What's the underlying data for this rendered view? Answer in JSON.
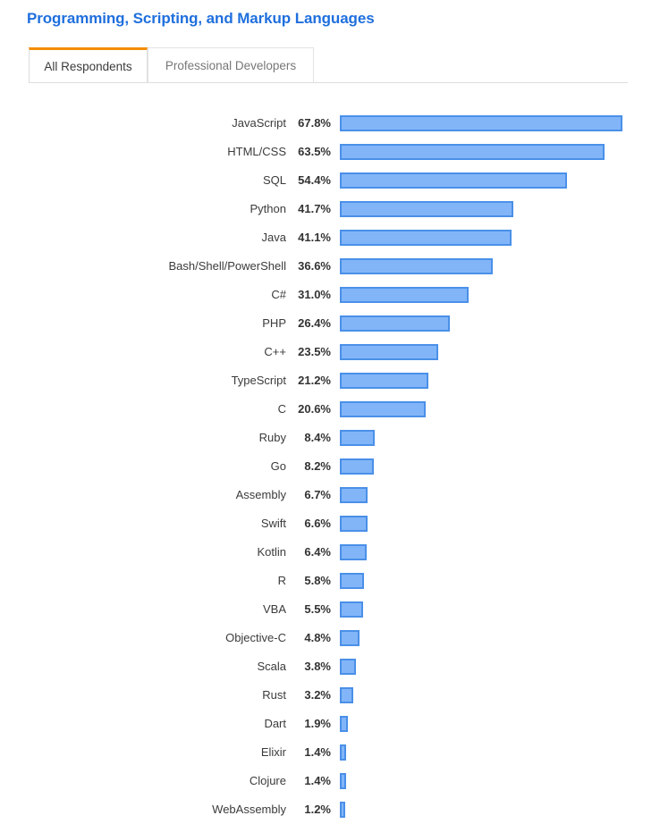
{
  "header": {
    "title": "Programming, Scripting, and Markup Languages"
  },
  "tabs": [
    {
      "label": "All Respondents",
      "active": true
    },
    {
      "label": "Professional Developers",
      "active": false
    }
  ],
  "colors": {
    "title": "#1f6fdd",
    "tab_active_indicator": "#f48c00",
    "bar_fill": "#82b5f8",
    "bar_border": "#4a90e8"
  },
  "chart_data": {
    "type": "bar",
    "title": "Programming, Scripting, and Markup Languages",
    "xlabel": "",
    "ylabel": "",
    "orientation": "horizontal",
    "grid": false,
    "legend": "none",
    "xlim": [
      0,
      67.8
    ],
    "value_suffix": "%",
    "categories": [
      "JavaScript",
      "HTML/CSS",
      "SQL",
      "Python",
      "Java",
      "Bash/Shell/PowerShell",
      "C#",
      "PHP",
      "C++",
      "TypeScript",
      "C",
      "Ruby",
      "Go",
      "Assembly",
      "Swift",
      "Kotlin",
      "R",
      "VBA",
      "Objective-C",
      "Scala",
      "Rust",
      "Dart",
      "Elixir",
      "Clojure",
      "WebAssembly"
    ],
    "values": [
      67.8,
      63.5,
      54.4,
      41.7,
      41.1,
      36.6,
      31.0,
      26.4,
      23.5,
      21.2,
      20.6,
      8.4,
      8.2,
      6.7,
      6.6,
      6.4,
      5.8,
      5.5,
      4.8,
      3.8,
      3.2,
      1.9,
      1.4,
      1.4,
      1.2
    ],
    "value_labels": [
      "67.8%",
      "63.5%",
      "54.4%",
      "41.7%",
      "41.1%",
      "36.6%",
      "31.0%",
      "26.4%",
      "23.5%",
      "21.2%",
      "20.6%",
      "8.4%",
      "8.2%",
      "6.7%",
      "6.6%",
      "6.4%",
      "5.8%",
      "5.5%",
      "4.8%",
      "3.8%",
      "3.2%",
      "1.9%",
      "1.4%",
      "1.4%",
      "1.2%"
    ]
  }
}
